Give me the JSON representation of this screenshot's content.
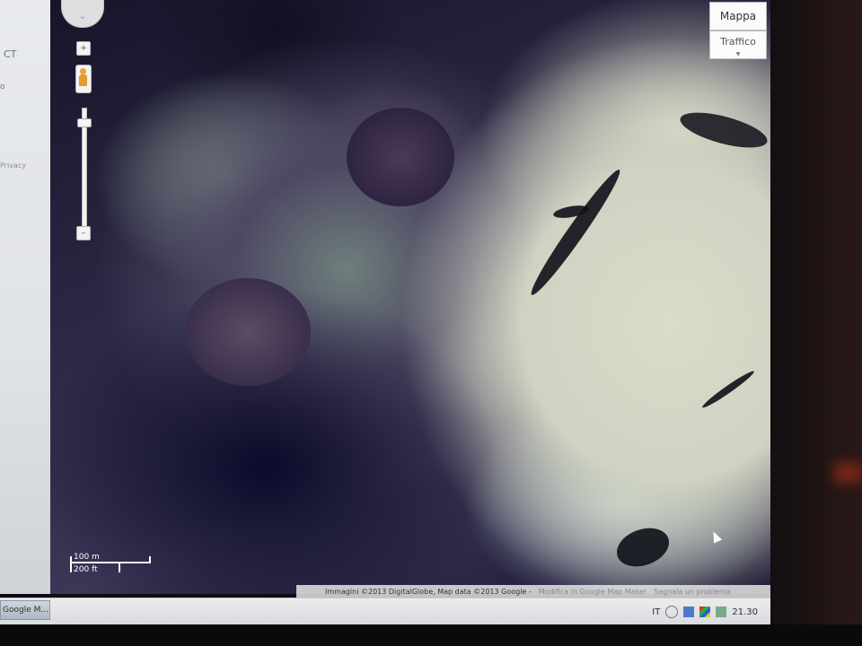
{
  "sidebar": {
    "text_ct": "CT",
    "text_dropdown": "o",
    "text_privacy": "Privacy"
  },
  "map": {
    "type_buttons": [
      {
        "label": "Mappa"
      },
      {
        "label": "Traffico"
      }
    ],
    "zoom_in_symbol": "+",
    "zoom_out_symbol": "–",
    "scale": {
      "metric": "100 m",
      "imperial": "200 ft"
    },
    "attribution": {
      "copyright": "Immagini ©2013 DigitalGlobe, Map data ©2013 Google -",
      "link1": "Modifica in Google Map Maker",
      "link2": "Segnala un problema"
    }
  },
  "taskbar": {
    "active_item": "Google M...",
    "language": "IT",
    "clock": "21.30"
  },
  "colors": {
    "accent_orange": "#e39a2e",
    "map_land": "#4d4863",
    "map_snow": "#d9dcc8"
  }
}
